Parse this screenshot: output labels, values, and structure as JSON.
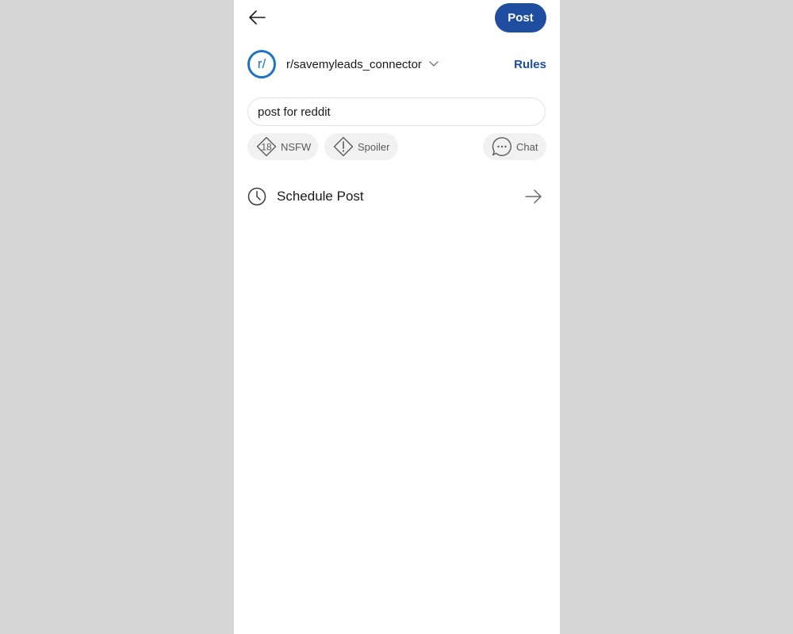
{
  "header": {
    "back_icon": "arrow-left-icon",
    "post_label": "Post"
  },
  "community": {
    "avatar_text": "r/",
    "name": "r/savemyleads_connector",
    "dropdown_icon": "chevron-down-icon",
    "rules_label": "Rules"
  },
  "title_field": {
    "value": "post for reddit"
  },
  "tags": {
    "nsfw": {
      "label": "NSFW",
      "icon": "nsfw-18-icon"
    },
    "spoiler": {
      "label": "Spoiler",
      "icon": "spoiler-exclamation-icon"
    },
    "chat": {
      "label": "Chat",
      "icon": "chat-bubble-icon"
    }
  },
  "schedule": {
    "label": "Schedule Post",
    "icon": "clock-icon",
    "arrow_icon": "arrow-right-icon"
  },
  "colors": {
    "accent": "#1f4da0",
    "community_ring": "#1f73c6",
    "background": "#d6d6d6",
    "chip_bg": "#f1f1f1"
  }
}
